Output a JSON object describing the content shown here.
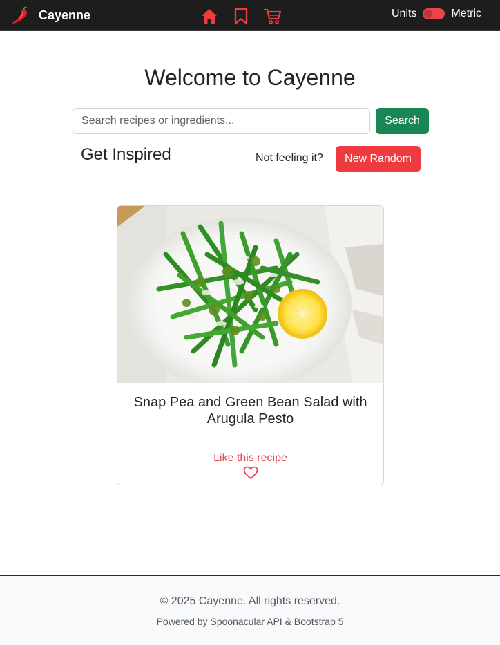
{
  "app": {
    "brand_name": "Cayenne",
    "logo_icon": "chili-pepper-icon"
  },
  "nav": {
    "icons": [
      "home-icon",
      "bookmark-icon",
      "cart-icon"
    ],
    "accent_color": "#ef3b3f"
  },
  "units_toggle": {
    "left_label": "Units",
    "right_label": "Metric",
    "state": "off"
  },
  "main": {
    "title": "Welcome to Cayenne",
    "search_placeholder": "Search recipes or ingredients...",
    "search_value": "",
    "search_button": "Search",
    "inspired_heading": "Get Inspired",
    "not_feeling_text": "Not feeling it?",
    "random_button": "New Random"
  },
  "recipe_card": {
    "title": "Snap Pea and Green Bean Salad with Arugula Pesto",
    "like_label": "Like this recipe",
    "like_icon": "heart-outline-icon",
    "liked": false
  },
  "footer": {
    "copyright": "© 2025 Cayenne. All rights reserved.",
    "powered_by": "Powered by Spoonacular API & Bootstrap 5"
  },
  "colors": {
    "navbar_bg": "#1d1d1d",
    "success": "#198754",
    "danger": "#ef3b3f",
    "footer_bg": "#f8f9fa"
  }
}
